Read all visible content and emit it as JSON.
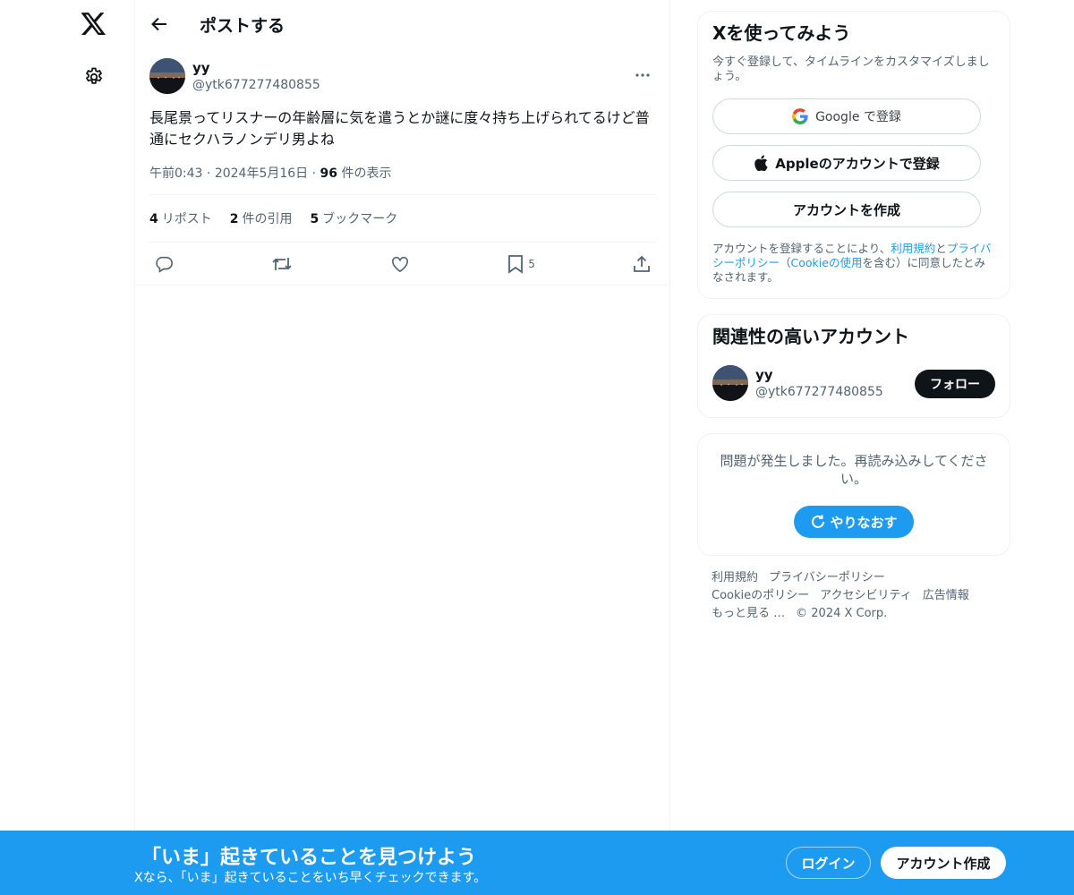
{
  "colors": {
    "accent": "#1d9bf0",
    "text": "#0f1419",
    "muted": "#536471",
    "border": "#eff3f4"
  },
  "nav": {
    "logo_icon": "x-logo-icon",
    "settings_icon": "gear-icon"
  },
  "header": {
    "title": "ポストする"
  },
  "post": {
    "author_name": "yy",
    "author_handle": "@ytk677277480855",
    "text": "長尾景ってリスナーの年齢層に気を遣うとか謎に度々持ち上げられてるけど普通にセクハラノンデリ男よね",
    "time": "午前0:43",
    "date": "2024年5月16日",
    "views_count": "96",
    "views_label": "件の表示",
    "stats": [
      {
        "count": "4",
        "label": "リポスト"
      },
      {
        "count": "2",
        "label": "件の引用"
      },
      {
        "count": "5",
        "label": "ブックマーク"
      }
    ],
    "bookmark_count": "5"
  },
  "signup": {
    "title": "Xを使ってみよう",
    "subtitle": "今すぐ登録して、タイムラインをカスタマイズしましょう。",
    "google_label": "Google で登録",
    "apple_label": "Appleのアカウントで登録",
    "create_label": "アカウントを作成",
    "legal_1": "アカウントを登録することにより、",
    "legal_terms": "利用規約",
    "legal_and": "と",
    "legal_privacy": "プライバシーポリシー",
    "legal_2": "（",
    "legal_cookie": "Cookieの使用",
    "legal_3": "を含む）に同意したとみなされます。"
  },
  "related": {
    "title": "関連性の高いアカウント",
    "name": "yy",
    "handle": "@ytk677277480855",
    "follow_label": "フォロー"
  },
  "error": {
    "text": "問題が発生しました。再読み込みしてください。",
    "retry_label": "やりなおす"
  },
  "footer": {
    "terms": "利用規約",
    "privacy": "プライバシーポリシー",
    "cookie": "Cookieのポリシー",
    "accessibility": "アクセシビリティ",
    "ads": "広告情報",
    "more": "もっと見る …",
    "copyright": "© 2024 X Corp."
  },
  "banner": {
    "title": "「いま」起きていることを見つけよう",
    "subtitle": "Xなら、「いま」起きていることをいち早くチェックできます。",
    "login_label": "ログイン",
    "create_label": "アカウント作成"
  }
}
